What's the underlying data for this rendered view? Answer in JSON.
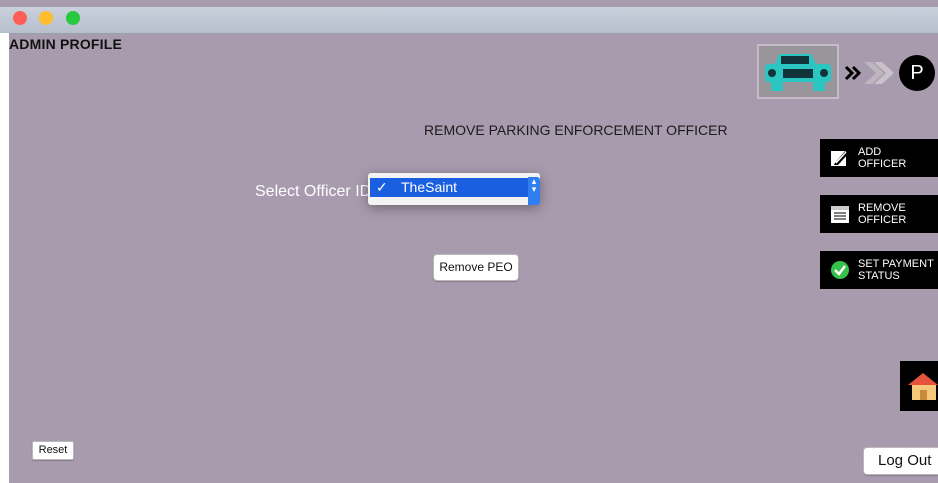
{
  "window": {
    "traffic_lights": [
      "#ff5f57",
      "#febc2e",
      "#28c840"
    ]
  },
  "header": {
    "title": "ADMIN PROFILE"
  },
  "main": {
    "heading": "REMOVE PARKING ENFORCEMENT OFFICER",
    "select_label": "Select Officer ID",
    "select": {
      "check": "✓",
      "value": "TheSaint"
    },
    "remove_button": "Remove PEO"
  },
  "sidebar": {
    "items": [
      {
        "label": "ADD\nOFFICER",
        "icon": "edit-icon"
      },
      {
        "label": "REMOVE\nOFFICER",
        "icon": "list-icon"
      },
      {
        "label": "SET PAYMENT\nSTATUS",
        "icon": "check-circle-icon"
      }
    ]
  },
  "logo": {
    "letter": "P",
    "car_color": "#2cc6c2"
  },
  "footer": {
    "reset_label": "Reset",
    "logout_label": "Log Out"
  },
  "colors": {
    "background": "#a89bae",
    "selection": "#1a5fe0"
  }
}
